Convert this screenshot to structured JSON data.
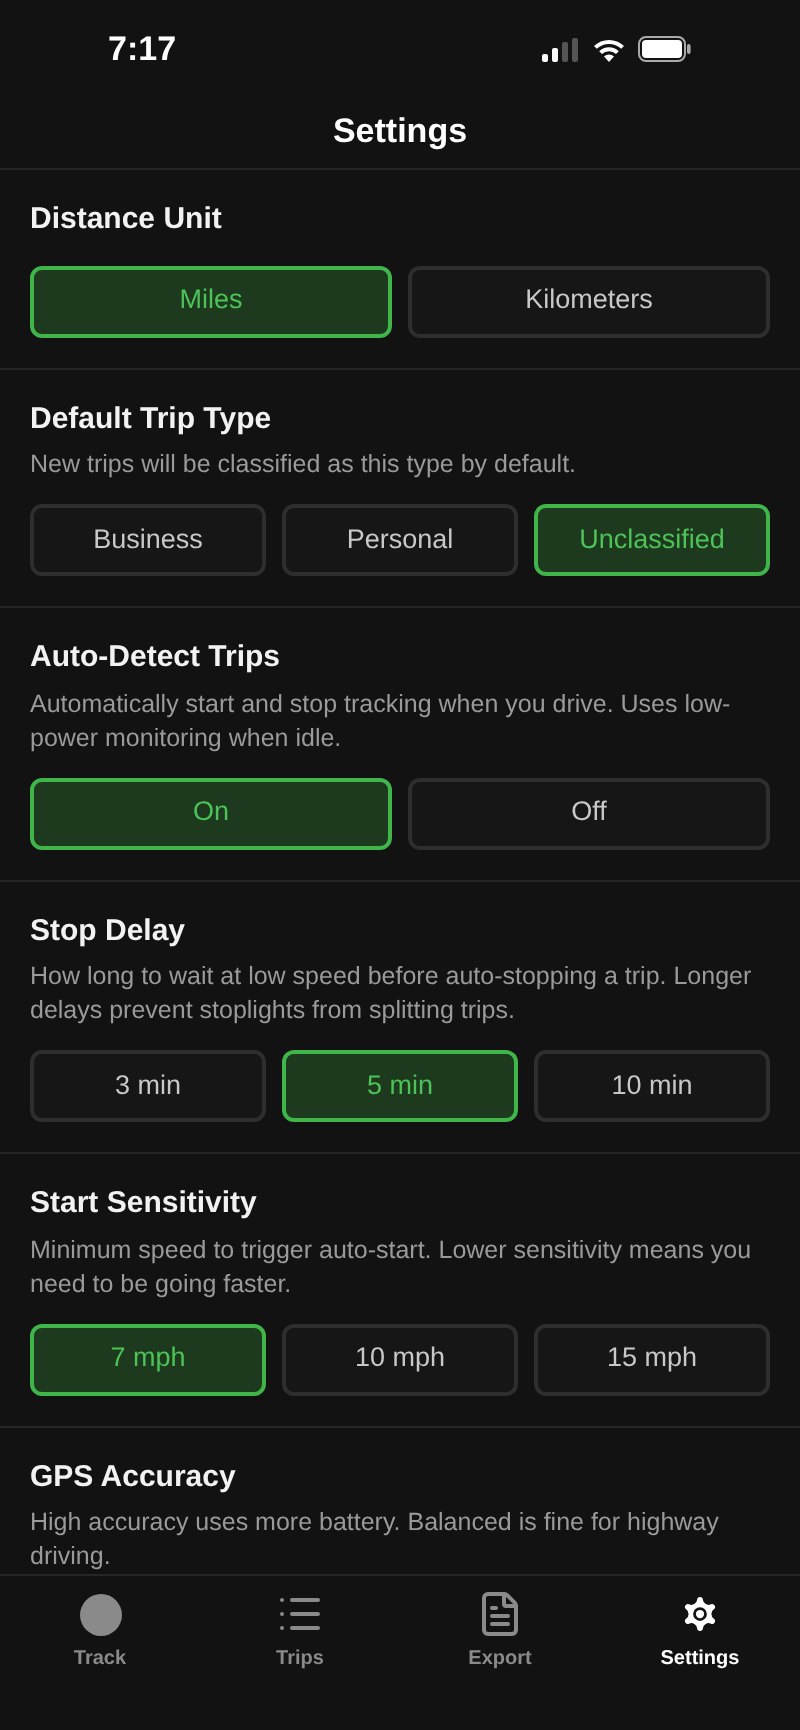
{
  "status_bar": {
    "time": "7:17"
  },
  "header": {
    "title": "Settings"
  },
  "sections": [
    {
      "title": "Distance Unit",
      "options": [
        {
          "label": "Miles",
          "selected": true
        },
        {
          "label": "Kilometers",
          "selected": false
        }
      ]
    },
    {
      "title": "Default Trip Type",
      "description": "New trips will be classified as this type by default.",
      "options": [
        {
          "label": "Business",
          "selected": false
        },
        {
          "label": "Personal",
          "selected": false
        },
        {
          "label": "Unclassified",
          "selected": true
        }
      ]
    },
    {
      "title": "Auto-Detect Trips",
      "description": "Automatically start and stop tracking when you drive. Uses low-power monitoring when idle.",
      "options": [
        {
          "label": "On",
          "selected": true
        },
        {
          "label": "Off",
          "selected": false
        }
      ]
    },
    {
      "title": "Stop Delay",
      "description": "How long to wait at low speed before auto-stopping a trip. Longer delays prevent stoplights from splitting trips.",
      "options": [
        {
          "label": "3 min",
          "selected": false
        },
        {
          "label": "5 min",
          "selected": true
        },
        {
          "label": "10 min",
          "selected": false
        }
      ]
    },
    {
      "title": "Start Sensitivity",
      "description": "Minimum speed to trigger auto-start. Lower sensitivity means you need to be going faster.",
      "options": [
        {
          "label": "7 mph",
          "selected": true
        },
        {
          "label": "10 mph",
          "selected": false
        },
        {
          "label": "15 mph",
          "selected": false
        }
      ]
    },
    {
      "title": "GPS Accuracy",
      "description": "High accuracy uses more battery. Balanced is fine for highway driving."
    }
  ],
  "tab_bar": [
    {
      "kind": "track",
      "label": "Track",
      "selected": false
    },
    {
      "kind": "trips",
      "label": "Trips",
      "selected": false
    },
    {
      "kind": "export",
      "label": "Export",
      "selected": false
    },
    {
      "kind": "settings",
      "label": "Settings",
      "selected": true
    }
  ]
}
